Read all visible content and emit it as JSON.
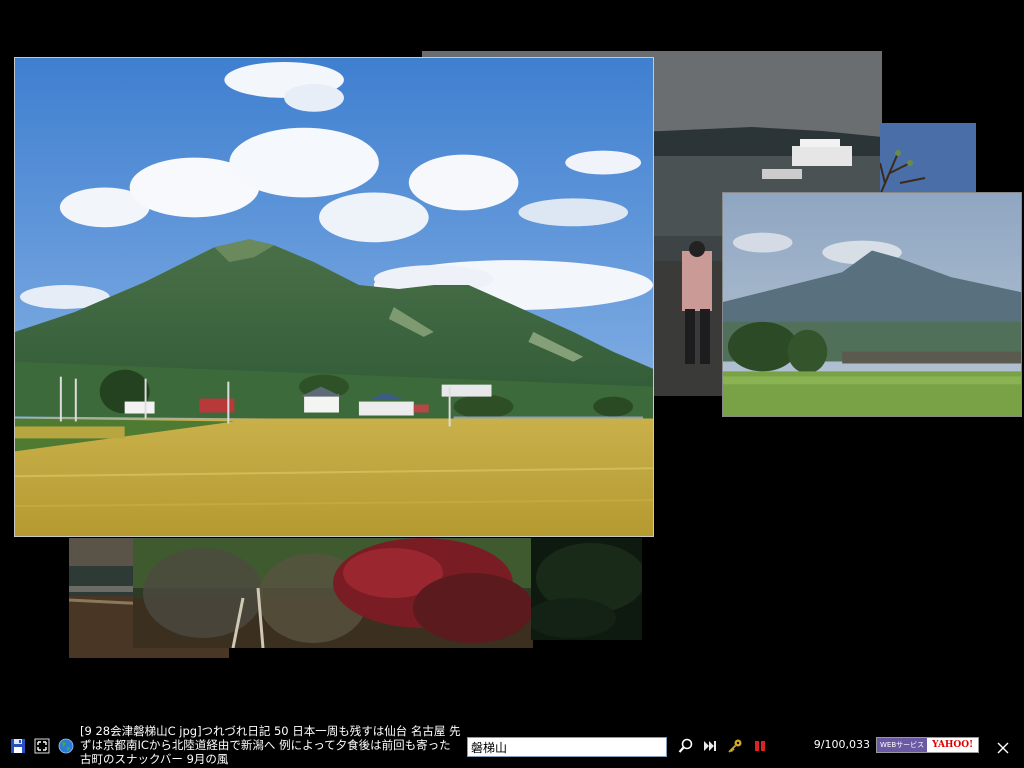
{
  "photos": [
    {
      "id": "marsh-boardwalk",
      "kind": "thumbnail"
    },
    {
      "id": "shrubs-red-leaves",
      "kind": "thumbnail"
    },
    {
      "id": "lake-boats",
      "kind": "thumbnail"
    },
    {
      "id": "blue-sky-branch",
      "kind": "thumbnail"
    },
    {
      "id": "mountain-field-small",
      "kind": "thumbnail"
    },
    {
      "id": "mount-bandai-main",
      "kind": "featured"
    }
  ],
  "toolbar": {
    "save_icon": "floppy-disk-icon",
    "resize_icon": "fullscreen-icon",
    "globe_icon": "globe-icon",
    "caption": "[9 28会津磐梯山C jpg]つれづれ日記 50 日本一周も残すは仙台 名古屋 先ずは京都南ICから北陸道経由で新潟へ 例によって夕食後は前回も寄った古町のスナックバー 9月の風",
    "search_value": "磐梯山",
    "search_icon": "magnifier-icon",
    "next_icon": "skip-forward-icon",
    "key_icon": "key-icon",
    "pause_icon": "pause-icon",
    "counter": "9/100,033",
    "badge_left": "WEBサービス",
    "badge_right": "YAHOO!",
    "close_icon": "close-icon"
  },
  "colors": {
    "background": "#000000",
    "caption_text": "#ffffff",
    "badge_purple": "#6a5aa6",
    "yahoo_red": "#dd0000"
  }
}
